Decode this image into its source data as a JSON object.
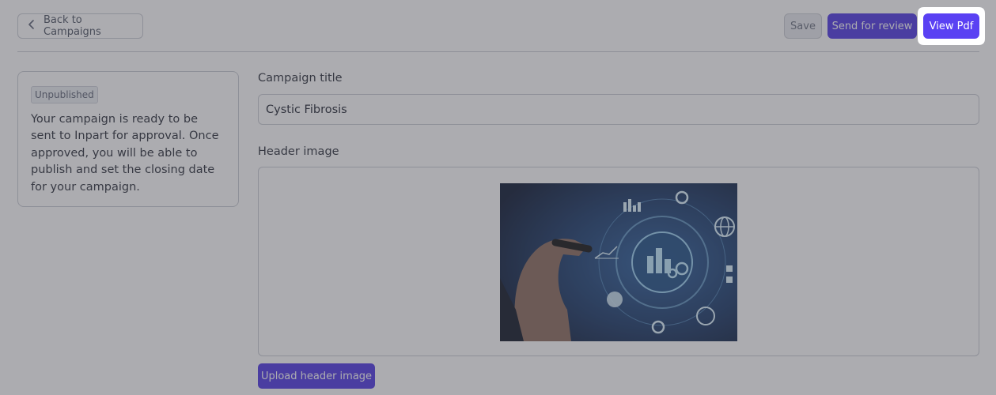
{
  "topbar": {
    "back_label": "Back to Campaigns",
    "save_label": "Save",
    "review_label": "Send for review",
    "pdf_label": "View Pdf"
  },
  "status": {
    "badge": "Unpublished",
    "message": "Your campaign is ready to be sent to Inpart for approval. Once approved, you will be able to publish and set the closing date for your campaign."
  },
  "form": {
    "title_label": "Campaign title",
    "title_value": "Cystic Fibrosis",
    "header_label": "Header image",
    "upload_label": "Upload header image"
  },
  "icons": {
    "back": "chevron-left-icon"
  },
  "colors": {
    "primary": "#4d36e3",
    "highlight": "#5a41f3",
    "overlay": "rgba(70,72,80,0.45)"
  }
}
